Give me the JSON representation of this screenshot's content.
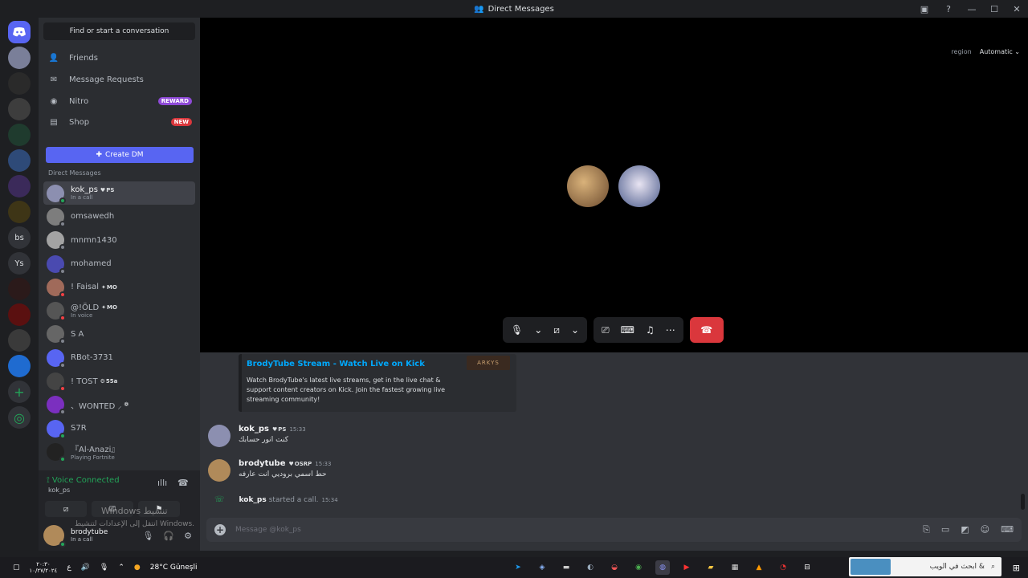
{
  "window": {
    "title": "Direct Messages"
  },
  "servers": [
    "bs",
    "Ys"
  ],
  "sidebar": {
    "search_label": "Find or start a conversation",
    "nav": [
      {
        "label": "Friends",
        "icon": "friends-icon"
      },
      {
        "label": "Message Requests",
        "icon": "mail-icon"
      },
      {
        "label": "Nitro",
        "icon": "nitro-icon",
        "badge": "REWARD"
      },
      {
        "label": "Shop",
        "icon": "shop-icon",
        "badge": "NEW"
      }
    ],
    "create_dm": "Create DM",
    "dm_header": "Direct Messages",
    "dms": [
      {
        "name": "kok_ps",
        "tag": "PS",
        "sub": "In a call",
        "status": "on"
      },
      {
        "name": "omsawedh",
        "tag": "",
        "sub": "",
        "status": "off"
      },
      {
        "name": "mnmn1430",
        "tag": "",
        "sub": "",
        "status": "off"
      },
      {
        "name": "mohamed",
        "tag": "",
        "sub": "",
        "status": "off"
      },
      {
        "name": "! Faisal",
        "tag": "MO",
        "sub": "",
        "status": "dnd"
      },
      {
        "name": "@!ÖLD",
        "tag": "MO",
        "sub": "In voice",
        "status": "dnd"
      },
      {
        "name": "S A",
        "tag": "",
        "sub": "",
        "status": "off"
      },
      {
        "name": "RBot-3731",
        "tag": "",
        "sub": "",
        "status": "off"
      },
      {
        "name": "! TOST",
        "tag": "55a",
        "sub": "",
        "status": "dnd"
      },
      {
        "name": "、WONTED ⸝",
        "tag": "",
        "sub": "",
        "status": "off"
      },
      {
        "name": "S7R",
        "tag": "",
        "sub": "",
        "status": "on"
      },
      {
        "name": "『Al-Anazi』",
        "tag": "",
        "sub": "Playing Fortnite",
        "status": "on"
      }
    ]
  },
  "voice": {
    "status": "Voice Connected",
    "channel": "kok_ps",
    "user_name": "brodytube",
    "user_sub": "In a call"
  },
  "stage": {
    "region_label": "region",
    "region_value": "Automatic"
  },
  "chat": {
    "embed": {
      "title": "BrodyTube Stream - Watch Live on Kick",
      "description": "Watch BrodyTube's latest live streams, get in the live chat & support content creators on Kick. Join the fastest growing live streaming community!",
      "thumb_text": "ARKYS"
    },
    "messages": [
      {
        "author": "kok_ps",
        "tag": "PS",
        "time": "15:33",
        "text": "كنت انور حسابك"
      },
      {
        "author": "brodytube",
        "tag": "OSRP",
        "time": "15:33",
        "text": "حط اسمي بروديي انت عارفه"
      }
    ],
    "system": {
      "author": "kok_ps",
      "text": "started a call.",
      "time": "15:34"
    },
    "composer_placeholder": "Message @kok_ps"
  },
  "watermark": {
    "line1": "Windows تنشيط",
    "line2": "انتقل إلى الإعدادات لتنشيط Windows."
  },
  "taskbar": {
    "clock_time": "٢٠:٣٠",
    "clock_date": "١٠/٢٧/٢٠٢٤",
    "lang": "ع",
    "weather": "28°C  Güneşli",
    "search_placeholder": "ابحث في الويب &"
  },
  "colors": {
    "accent": "#5865f2",
    "danger": "#da373c",
    "online": "#23a559"
  }
}
